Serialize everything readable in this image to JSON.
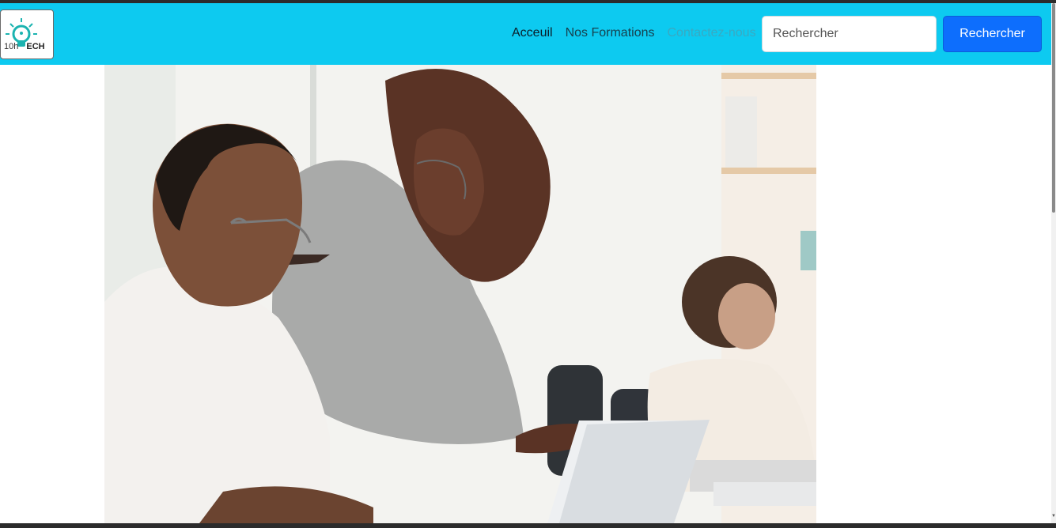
{
  "brand": {
    "logo_text_prefix": "10h",
    "logo_text_main": "ECH",
    "logo_icon": "lightbulb-icon"
  },
  "nav": {
    "links": [
      {
        "label": "Acceuil",
        "state": "active"
      },
      {
        "label": "Nos Formations",
        "state": "normal"
      },
      {
        "label": "Contactez-nous",
        "state": "muted"
      }
    ]
  },
  "search": {
    "placeholder": "Rechercher",
    "button_label": "Rechercher"
  },
  "colors": {
    "navbar": "#0dcaf0",
    "button": "#0d6efd"
  },
  "hero": {
    "image_icon": "hero-photo"
  }
}
